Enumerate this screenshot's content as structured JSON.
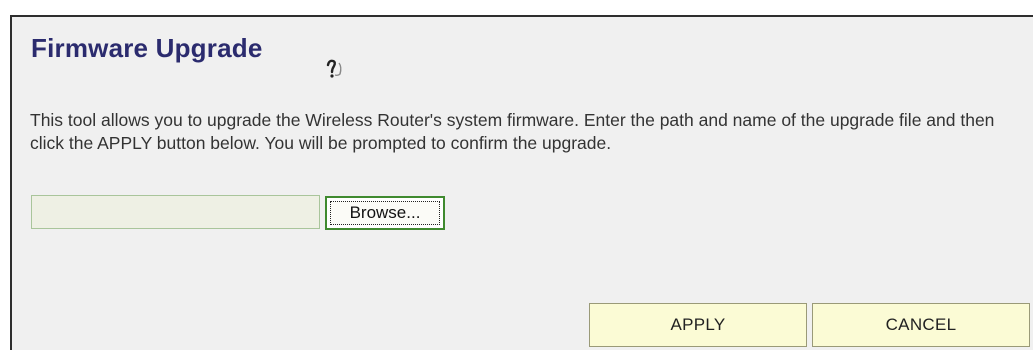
{
  "page": {
    "title": "Firmware Upgrade",
    "help_icon": "help-question-icon",
    "description": "This tool allows you to upgrade the Wireless Router's system firmware. Enter the path and name of the upgrade file and then click the APPLY button below. You will be prompted to confirm the upgrade."
  },
  "file_upload": {
    "value": "",
    "browse_label": "Browse..."
  },
  "actions": {
    "apply_label": "APPLY",
    "cancel_label": "CANCEL"
  },
  "colors": {
    "title": "#2b2b6e",
    "panel_background": "#f0f0f0",
    "button_background": "#fbfbd5",
    "browse_border": "#3f8a2f"
  }
}
